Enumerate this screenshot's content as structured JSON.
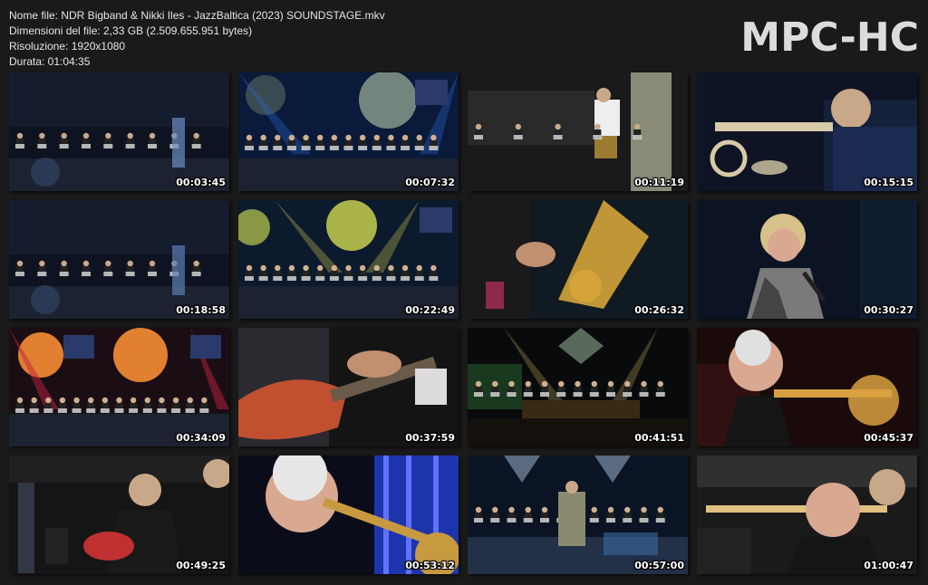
{
  "file_info": {
    "name_line": "Nome file: NDR Bigband & Nikki Iles - JazzBaltica (2023) SOUNDSTAGE.mkv",
    "size_line": "Dimensioni del file: 2,33 GB (2.509.655.951 bytes)",
    "resolution_line": "Risoluzione: 1920x1080",
    "duration_line": "Durata: 01:04:35"
  },
  "logo": "MPC-HC",
  "thumbnails": [
    {
      "timestamp": "00:03:45",
      "scene": "band-dark",
      "accent": "#6a8fc0"
    },
    {
      "timestamp": "00:07:32",
      "scene": "stage-blue",
      "accent": "#2a6bd0"
    },
    {
      "timestamp": "00:11:19",
      "scene": "band-closeup",
      "accent": "#c8c8c8"
    },
    {
      "timestamp": "00:15:15",
      "scene": "trumpet",
      "accent": "#d8c9a8"
    },
    {
      "timestamp": "00:18:58",
      "scene": "band-dark",
      "accent": "#5b7fb0"
    },
    {
      "timestamp": "00:22:49",
      "scene": "stage-yellow",
      "accent": "#e4d84a"
    },
    {
      "timestamp": "00:26:32",
      "scene": "saxophone",
      "accent": "#d4a43a"
    },
    {
      "timestamp": "00:30:27",
      "scene": "singer",
      "accent": "#d8c08a"
    },
    {
      "timestamp": "00:34:09",
      "scene": "stage-orange",
      "accent": "#e08030"
    },
    {
      "timestamp": "00:37:59",
      "scene": "guitar",
      "accent": "#c05030"
    },
    {
      "timestamp": "00:41:51",
      "scene": "stage-wide",
      "accent": "#c8b060"
    },
    {
      "timestamp": "00:45:37",
      "scene": "trombone",
      "accent": "#d8a040"
    },
    {
      "timestamp": "00:49:25",
      "scene": "guitarist",
      "accent": "#c03030"
    },
    {
      "timestamp": "00:53:12",
      "scene": "trombone-blue",
      "accent": "#2040d0"
    },
    {
      "timestamp": "00:57:00",
      "scene": "conductor",
      "accent": "#3a6aa0"
    },
    {
      "timestamp": "01:00:47",
      "scene": "band-side",
      "accent": "#e0c080"
    }
  ]
}
